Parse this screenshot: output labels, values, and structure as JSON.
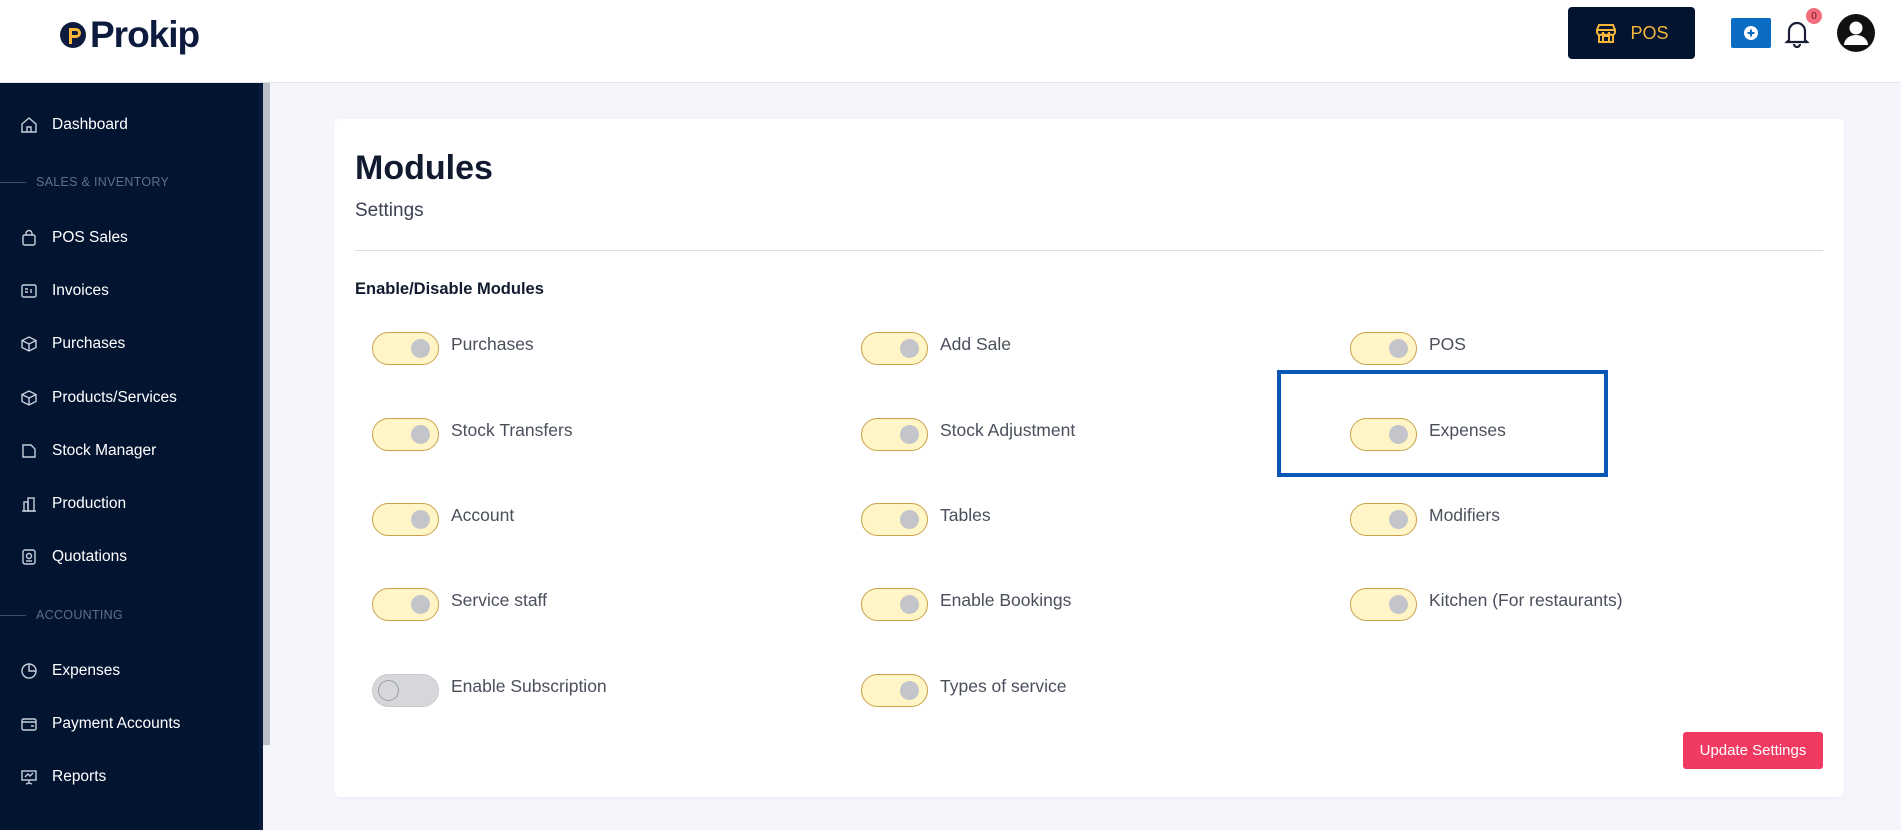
{
  "header": {
    "logo_text": "Prokip",
    "pos_label": "POS",
    "notification_count": "0"
  },
  "sidebar": {
    "items": [
      {
        "label": "Dashboard",
        "icon": "home-icon"
      },
      {
        "label": "POS Sales",
        "icon": "bag-icon"
      },
      {
        "label": "Invoices",
        "icon": "invoice-icon"
      },
      {
        "label": "Purchases",
        "icon": "purchase-box-icon"
      },
      {
        "label": "Products/Services",
        "icon": "product-box-icon"
      },
      {
        "label": "Stock Manager",
        "icon": "folder-icon"
      },
      {
        "label": "Production",
        "icon": "building-icon"
      },
      {
        "label": "Quotations",
        "icon": "quotation-icon"
      },
      {
        "label": "Expenses",
        "icon": "pie-chart-icon"
      },
      {
        "label": "Payment Accounts",
        "icon": "wallet-icon"
      },
      {
        "label": "Reports",
        "icon": "presentation-icon"
      }
    ],
    "sections": [
      "SALES & INVENTORY",
      "ACCOUNTING"
    ]
  },
  "main": {
    "title": "Modules",
    "subtitle": "Settings",
    "section_heading": "Enable/Disable Modules",
    "modules": [
      {
        "label": "Purchases",
        "enabled": true
      },
      {
        "label": "Add Sale",
        "enabled": true
      },
      {
        "label": "POS",
        "enabled": true
      },
      {
        "label": "Stock Transfers",
        "enabled": true
      },
      {
        "label": "Stock Adjustment",
        "enabled": true
      },
      {
        "label": "Expenses",
        "enabled": true
      },
      {
        "label": "Account",
        "enabled": true
      },
      {
        "label": "Tables",
        "enabled": true
      },
      {
        "label": "Modifiers",
        "enabled": true
      },
      {
        "label": "Service staff",
        "enabled": true
      },
      {
        "label": "Enable Bookings",
        "enabled": true
      },
      {
        "label": "Kitchen (For restaurants)",
        "enabled": true
      },
      {
        "label": "Enable Subscription",
        "enabled": false
      },
      {
        "label": "Types of service",
        "enabled": true
      }
    ],
    "update_button_label": "Update Settings"
  },
  "colors": {
    "sidebar_bg": "#031431",
    "pos_accent": "#f5b63a",
    "toggle_on_bg": "#fff5c6",
    "update_button": "#f03a61",
    "highlight": "#0b57b5"
  }
}
